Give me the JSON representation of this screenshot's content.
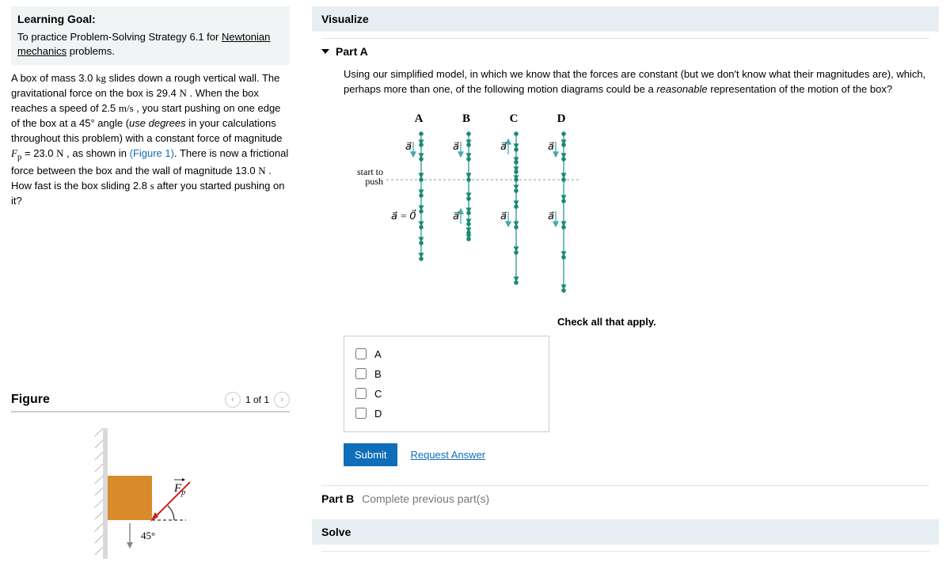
{
  "left": {
    "learning_goal_title": "Learning Goal:",
    "learning_goal_prefix": "To practice Problem-Solving Strategy 6.1 for ",
    "learning_goal_link": "Newtonian mechanics",
    "learning_goal_suffix": " problems.",
    "problem": {
      "p1a": "A box of mass 3.0 ",
      "u_kg": "kg",
      "p1b": " slides down a rough vertical wall. The gravitational force on the box is 29.4 ",
      "u_n1": "N",
      "p1c": " . When the box reaches a speed of 2.5 ",
      "u_ms": "m/s",
      "p1d": " , you start pushing on one edge of the box at a 45° angle (",
      "italic1": "use degrees",
      "p1e": " in your calculations throughout this problem) with a constant force of magnitude ",
      "fp": "F",
      "fpsub": "p",
      "p1f": " = 23.0 ",
      "u_n2": "N",
      "p1g": " , as shown in ",
      "fig_link": "(Figure 1)",
      "p1h": ". There is now a frictional force between the box and the wall of magnitude 13.0 ",
      "u_n3": "N",
      "p1i": " . How fast is the box sliding 2.8 ",
      "u_s": "s",
      "p1j": " after you started pushing on it?"
    }
  },
  "figure": {
    "title": "Figure",
    "counter": "1 of 1",
    "angle": "45°",
    "force_f": "F",
    "force_p": "p",
    "arrow_left": "‹",
    "arrow_right": "›"
  },
  "right": {
    "visualize": "Visualize",
    "part_a": "Part A",
    "question_a": "Using our simplified model, in which we know that the forces are constant (but we don't know what their magnitudes are), which, perhaps more than one, of the following motion diagrams could be a ",
    "question_a_italic": "reasonable",
    "question_a_tail": " representation of the motion of the box?",
    "diagram": {
      "col_a": "A",
      "col_b": "B",
      "col_c": "C",
      "col_d": "D",
      "start_push": "start to\npush",
      "a_vec": "a⃗",
      "a_zero": "a⃗ = 0⃗"
    },
    "instruction": "Check all that apply.",
    "options": {
      "a": "A",
      "b": "B",
      "c": "C",
      "d": "D"
    },
    "submit": "Submit",
    "request_answer": "Request Answer",
    "part_b_label": "Part B",
    "part_b_text": "Complete previous part(s)",
    "solve": "Solve"
  }
}
